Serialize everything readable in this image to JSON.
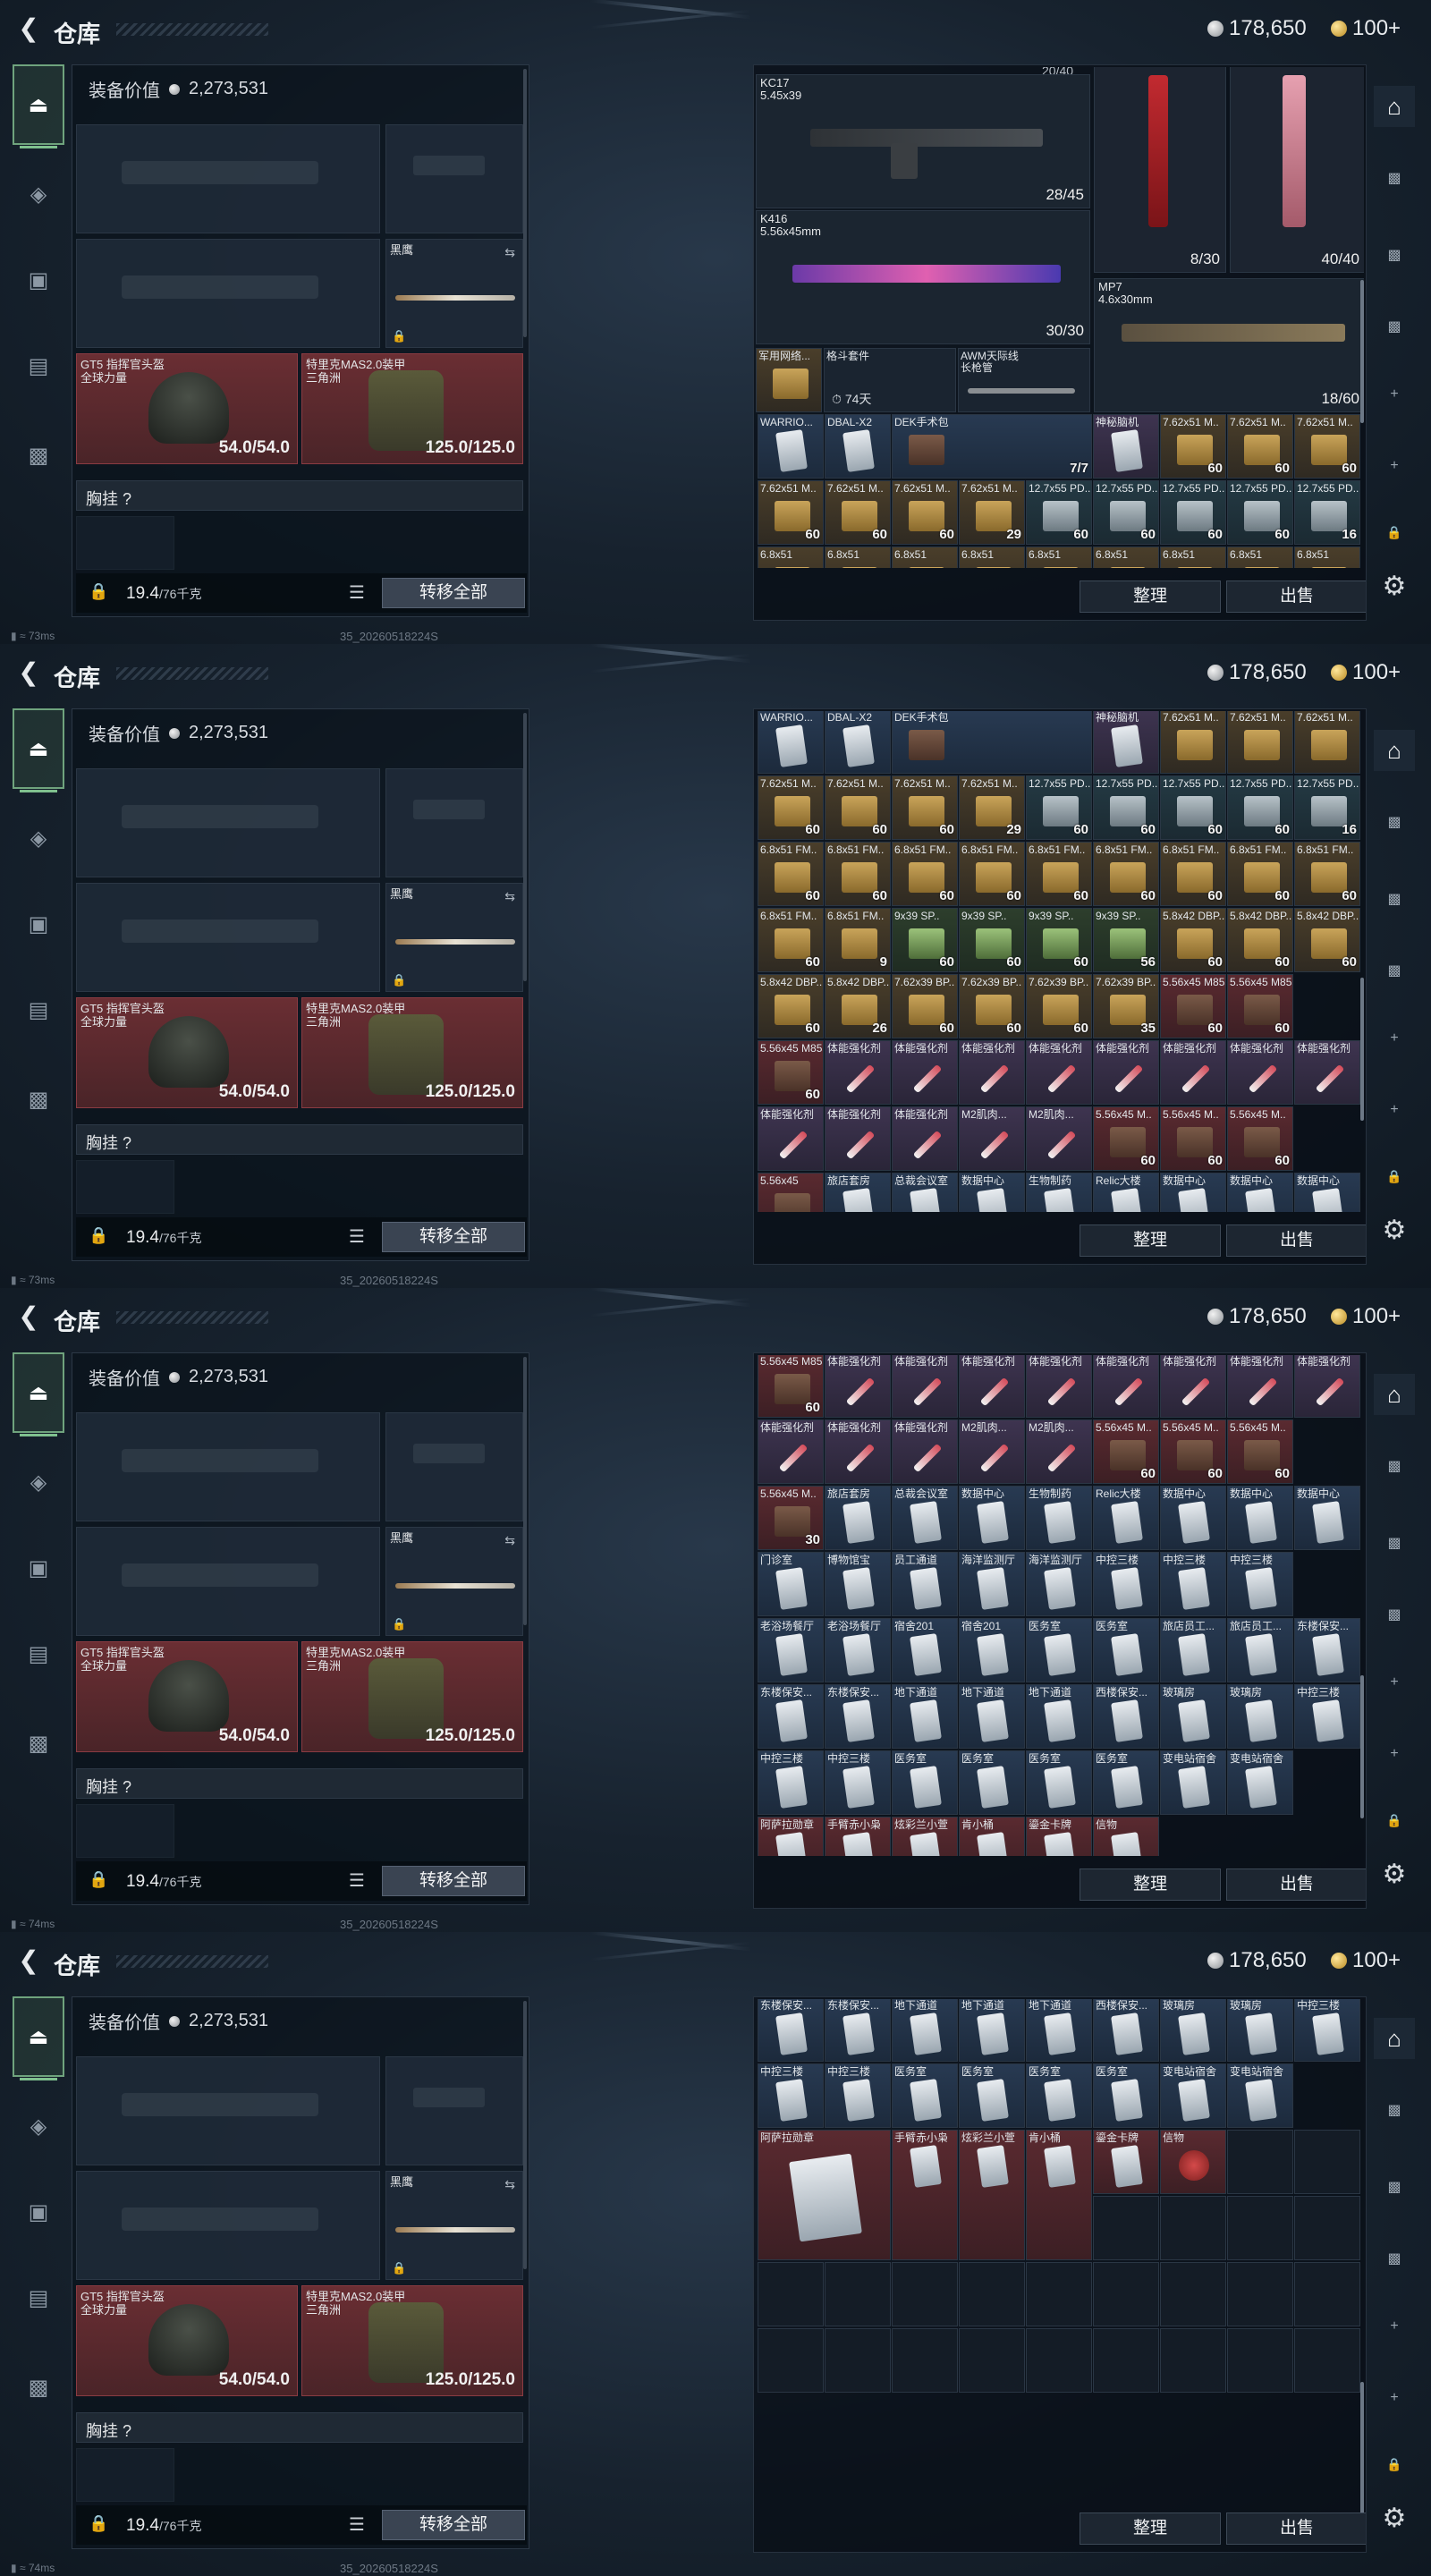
{
  "header": {
    "title": "仓库",
    "silver": "178,650",
    "gold": "100+"
  },
  "loadout": {
    "value_label": "装备价值",
    "value": "2,273,531",
    "knife_label": "黑鹰",
    "helmet_label": "GT5 指挥官头盔",
    "helmet_sub": "全球力量",
    "helmet_dur": "54.0/54.0",
    "armor_label": "特里克MAS2.0装甲",
    "armor_sub": "三角洲",
    "armor_dur": "125.0/125.0",
    "chest_label": "胸挂 ?",
    "weight": "19.4",
    "weight_max": "/76千克",
    "transfer_all": "转移全部"
  },
  "stash": {
    "sort": "整理",
    "sell": "出售",
    "frame1": {
      "cap_text": "20/40",
      "kc17_name": "KC17",
      "kc17_cal": "5.45x39",
      "kc17_ammo": "28/45",
      "gun_red_ammo": "8/30",
      "gun_pink_ammo": "40/40",
      "k416_name": "K416",
      "k416_cal": "5.56x45mm",
      "k416_ammo": "30/30",
      "mp7_name": "MP7",
      "mp7_cal": "4.6x30mm",
      "mp7_ammo": "18/60",
      "kit_name": "军用网络...",
      "fight_name": "格斗套件",
      "timer": "74天",
      "awm_name": "AWM天际线",
      "awm_sub": "长枪管"
    },
    "rows": {
      "r_warrior": [
        "WARRIO...",
        "DBAL-X2",
        "DEK手术包",
        "7/7",
        "神秘脑机",
        "7.62x51 M..",
        "7.62x51 M..",
        "7.62x51 M.."
      ],
      "r_ammo1_names": [
        "7.62x51 M..",
        "7.62x51 M..",
        "7.62x51 M..",
        "7.62x51 M..",
        "12.7x55 PD..",
        "12.7x55 PD..",
        "12.7x55 PD..",
        "12.7x55 PD..",
        "12.7x55 PD.."
      ],
      "r_ammo1_counts": [
        "60",
        "60",
        "60",
        "29",
        "60",
        "60",
        "60",
        "60",
        "16"
      ],
      "r_ammo2_names": [
        "6.8x51 FM..",
        "6.8x51 FM..",
        "6.8x51 FM..",
        "6.8x51 FM..",
        "6.8x51 FM..",
        "6.8x51 FM..",
        "6.8x51 FM..",
        "6.8x51 FM..",
        "6.8x51 FM.."
      ],
      "r_ammo2_counts": [
        "60",
        "60",
        "60",
        "60",
        "60",
        "60",
        "60",
        "60",
        "60"
      ],
      "r_ammo3_names": [
        "6.8x51 FM..",
        "6.8x51 FM..",
        "9x39 SP..",
        "9x39 SP..",
        "9x39 SP..",
        "9x39 SP..",
        "5.8x42 DBP..",
        "5.8x42 DBP..",
        "5.8x42 DBP.."
      ],
      "r_ammo3_counts": [
        "60",
        "9",
        "60",
        "60",
        "60",
        "56",
        "60",
        "60",
        "60"
      ],
      "r_ammo4_names": [
        "5.8x42 DBP..",
        "5.8x42 DBP..",
        "7.62x39 BP..",
        "7.62x39 BP..",
        "7.62x39 BP..",
        "7.62x39 BP..",
        "5.56x45 M855A1",
        "5.56x45 M855A1"
      ],
      "r_ammo4_counts": [
        "60",
        "26",
        "60",
        "60",
        "60",
        "35",
        "60",
        "60"
      ],
      "r_syr1": [
        "5.56x45 M855A1",
        "体能强化剂",
        "体能强化剂",
        "体能强化剂",
        "体能强化剂",
        "体能强化剂",
        "体能强化剂",
        "体能强化剂",
        "体能强化剂"
      ],
      "r_syr1_counts": [
        "60",
        "",
        "",
        "",
        "",
        "",
        "",
        "",
        ""
      ],
      "r_syr2": [
        "体能强化剂",
        "体能强化剂",
        "体能强化剂",
        "M2肌肉...",
        "M2肌肉...",
        "5.56x45 M..",
        "5.56x45 M..",
        "5.56x45 M.."
      ],
      "r_syr2_counts": [
        "",
        "",
        "",
        "",
        "",
        "60",
        "60",
        "60"
      ],
      "r_cards1": [
        "5.56x45 M..",
        "旅店套房",
        "总裁会议室",
        "数据中心",
        "生物制药",
        "Relic大楼",
        "数据中心",
        "数据中心",
        "数据中心"
      ],
      "r_cards1_counts": [
        "30",
        "",
        "",
        "",
        "",
        "",
        "",
        "",
        ""
      ],
      "r_cards2": [
        "门诊室",
        "博物馆宝",
        "员工通道",
        "海洋监测厅",
        "海洋监测厅",
        "中控三楼",
        "中控三楼",
        "中控三楼"
      ],
      "r_cards3": [
        "老浴场餐厅",
        "老浴场餐厅",
        "宿舍201",
        "宿舍201",
        "医务室",
        "医务室",
        "旅店员工...",
        "旅店员工...",
        "东楼保安..."
      ],
      "r_cards4": [
        "东楼保安...",
        "东楼保安...",
        "地下通道",
        "地下通道",
        "地下通道",
        "西楼保安...",
        "玻璃房",
        "玻璃房",
        "中控三楼"
      ],
      "r_cards5": [
        "中控三楼",
        "中控三楼",
        "医务室",
        "医务室",
        "医务室",
        "医务室",
        "变电站宿舍",
        "变电站宿舍"
      ],
      "r_collect": [
        "阿萨拉勋章",
        "手臂赤小枭",
        "炫彩兰小萱",
        "肯小桶",
        "鎏金卡牌",
        "信物"
      ],
      "last_row_peek": [
        "6.8x51",
        "6.8x51",
        "6.8x51",
        "6.8x51",
        "6.8x51",
        "6.8x51",
        "6.8x51",
        "6.8x51",
        "6.8x51"
      ],
      "peek2": [
        "5.56x45",
        "旅店套房",
        "总裁会议室",
        "数据中心",
        "生物制药",
        "Relic大楼",
        "数据中心",
        "数据中心",
        "数据中心"
      ]
    }
  },
  "status": {
    "ping1": "73ms",
    "ping2": "74ms",
    "uid": "35_20260518224S"
  },
  "icons": {
    "back": "chevron-left-icon",
    "gun": "gun-icon",
    "helmet": "helmet-icon",
    "backpack": "backpack-icon",
    "clipboard": "clipboard-icon",
    "briefcase": "briefcase-icon",
    "safe": "safe-icon",
    "gear": "gear-icon",
    "plus": "plus-icon",
    "lock": "lock-icon"
  }
}
